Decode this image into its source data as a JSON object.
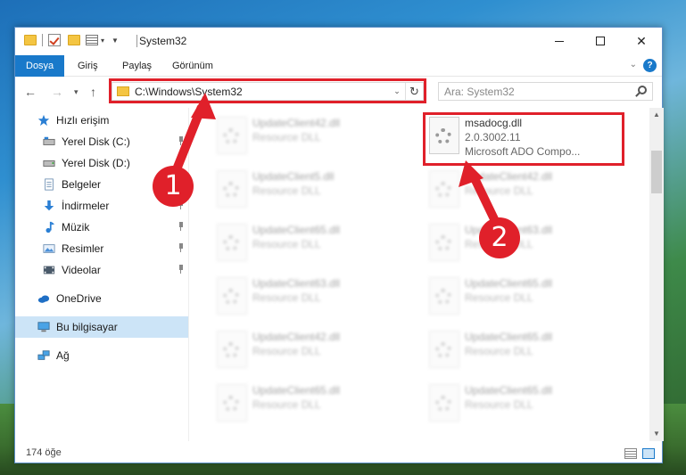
{
  "window": {
    "title": "System32"
  },
  "ribbon": {
    "tabs": [
      {
        "label": "Dosya",
        "active": true
      },
      {
        "label": "Giriş",
        "active": false
      },
      {
        "label": "Paylaş",
        "active": false
      },
      {
        "label": "Görünüm",
        "active": false
      }
    ],
    "help_icon": "?"
  },
  "navbar": {
    "address": "C:\\Windows\\System32",
    "search_placeholder": "Ara: System32"
  },
  "sidebar": {
    "items": [
      {
        "label": "Hızlı erişim",
        "icon": "star-icon",
        "pinned": false
      },
      {
        "label": "Yerel Disk (C:)",
        "icon": "drive-icon",
        "pinned": true
      },
      {
        "label": "Yerel Disk (D:)",
        "icon": "drive-icon",
        "pinned": true
      },
      {
        "label": "Belgeler",
        "icon": "documents-icon",
        "pinned": true
      },
      {
        "label": "İndirmeler",
        "icon": "download-icon",
        "pinned": true
      },
      {
        "label": "Müzik",
        "icon": "music-icon",
        "pinned": true
      },
      {
        "label": "Resimler",
        "icon": "pictures-icon",
        "pinned": true
      },
      {
        "label": "Videolar",
        "icon": "videos-icon",
        "pinned": true
      },
      {
        "label": "OneDrive",
        "icon": "cloud-icon",
        "pinned": false
      },
      {
        "label": "Bu bilgisayar",
        "icon": "computer-icon",
        "pinned": false,
        "selected": true
      },
      {
        "label": "Ağ",
        "icon": "network-icon",
        "pinned": false
      }
    ]
  },
  "files": {
    "left_column": [
      {
        "name": "UpdateClient42.dll",
        "type": "Resource DLL"
      },
      {
        "name": "UpdateClient5.dll",
        "type": "Resource DLL"
      },
      {
        "name": "UpdateClient65.dll",
        "type": "Resource DLL"
      },
      {
        "name": "UpdateClient63.dll",
        "type": "Resource DLL"
      },
      {
        "name": "UpdateClient42.dll",
        "type": "Resource DLL"
      },
      {
        "name": "UpdateClient65.dll",
        "type": "Resource DLL"
      }
    ],
    "right_column": [
      {
        "name": "msadocg.dll",
        "version": "2.0.3002.11",
        "description": "Microsoft ADO Compo...",
        "highlighted": true
      },
      {
        "name": "UpdateClient42.dll",
        "type": "Resource DLL"
      },
      {
        "name": "UpdateClient63.dll",
        "type": "Resource DLL"
      },
      {
        "name": "UpdateClient65.dll",
        "type": "Resource DLL"
      },
      {
        "name": "UpdateClient65.dll",
        "type": "Resource DLL"
      },
      {
        "name": "UpdateClient65.dll",
        "type": "Resource DLL"
      }
    ]
  },
  "status": {
    "item_count": "174 öğe"
  },
  "annotations": {
    "step1": "1",
    "step2": "2",
    "color": "#e0202a"
  }
}
